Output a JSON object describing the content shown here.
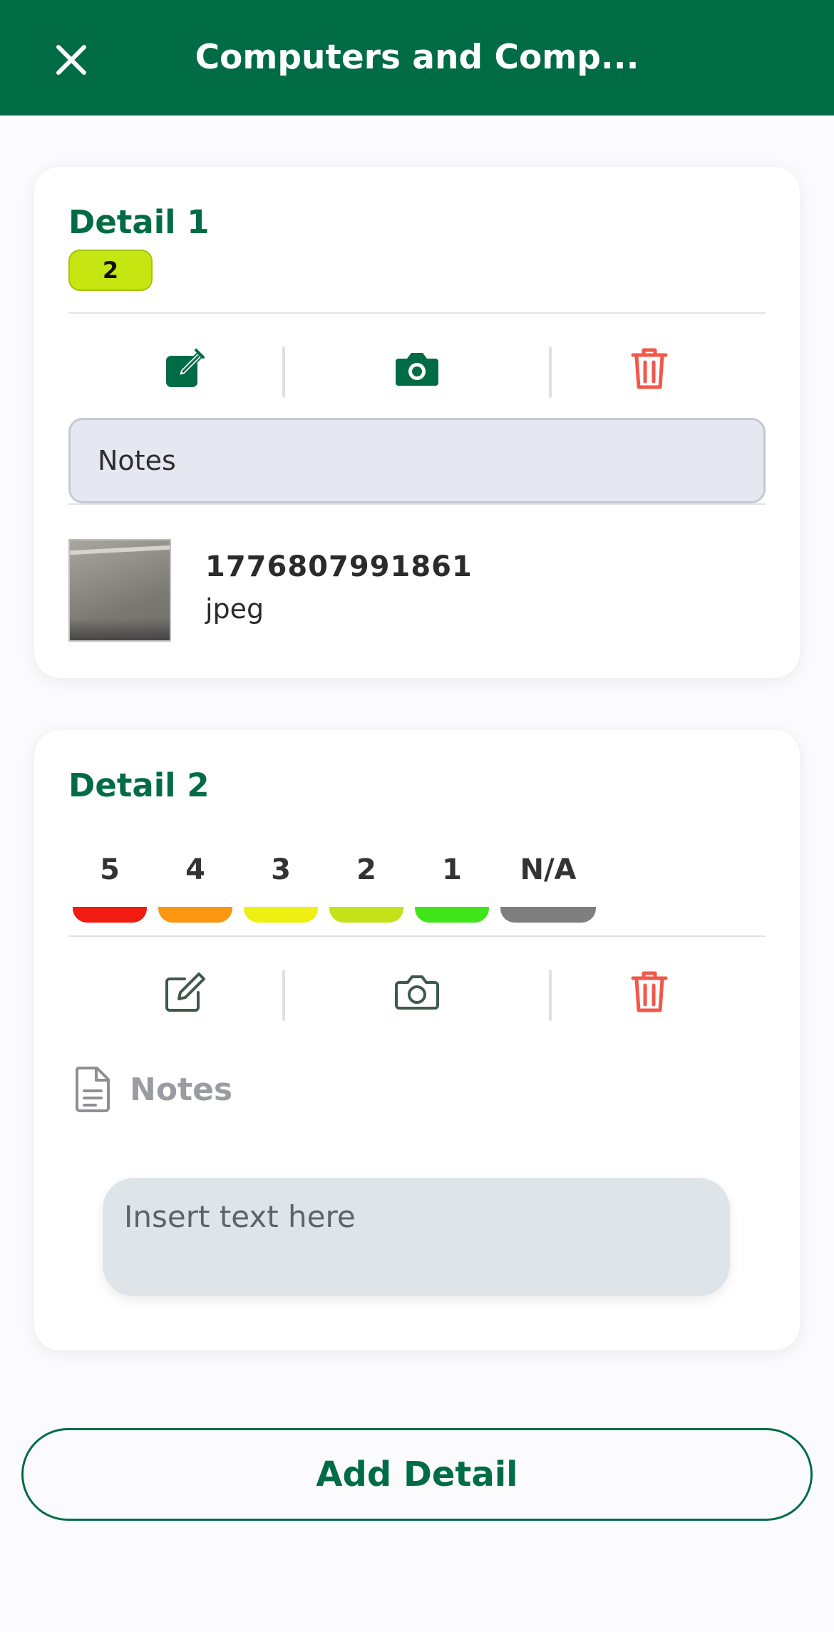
{
  "header": {
    "title": "Computers and Comp...",
    "background": "#006c45"
  },
  "details": [
    {
      "title": "Detail 1",
      "badge": "2",
      "badge_color": "#c6e611",
      "notes_value": "Notes",
      "attachment": {
        "name": "1776807991861",
        "ext": "jpeg"
      },
      "icons": [
        "edit-filled-icon",
        "camera-filled-icon",
        "trash-icon"
      ]
    },
    {
      "title": "Detail 2",
      "ratings": [
        {
          "label": "5",
          "color": "#f21b12"
        },
        {
          "label": "4",
          "color": "#fb9611"
        },
        {
          "label": "3",
          "color": "#eef012"
        },
        {
          "label": "2",
          "color": "#c3e21a"
        },
        {
          "label": "1",
          "color": "#40e51a"
        },
        {
          "label": "N/A",
          "color": "#7f7f7f"
        }
      ],
      "notes_label": "Notes",
      "text_placeholder": "Insert text here",
      "icons": [
        "edit-outline-icon",
        "camera-outline-icon",
        "trash-icon",
        "document-icon"
      ]
    }
  ],
  "add_button": "Add Detail",
  "colors": {
    "brand_green": "#006c45",
    "delete_red": "#f2574a"
  }
}
